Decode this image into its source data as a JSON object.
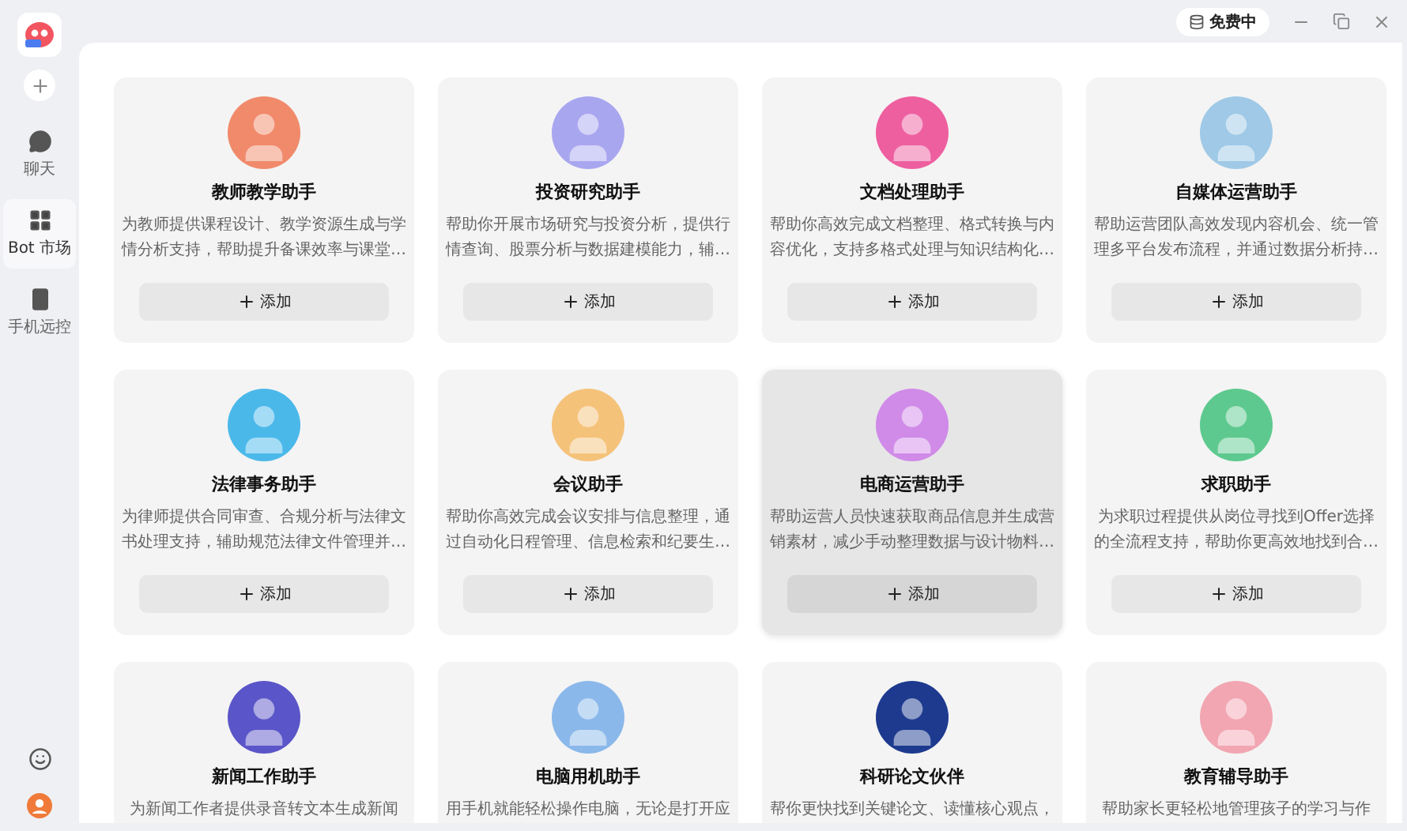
{
  "sidebar": {
    "items": [
      {
        "label": "聊天",
        "selected": false
      },
      {
        "label": "Bot 市场",
        "selected": true
      },
      {
        "label": "手机远控",
        "selected": false
      }
    ]
  },
  "top_bar": {
    "plan_badge": "免费中"
  },
  "cards": [
    {
      "title": "教师教学助手",
      "description": "为教师提供课程设计、教学资源生成与学情分析支持，帮助提升备课效率与课堂…",
      "button": "添加",
      "color": "#f08a6a",
      "highlighted": false
    },
    {
      "title": "投资研究助手",
      "description": "帮助你开展市场研究与投资分析，提供行情查询、股票分析与数据建模能力，辅…",
      "button": "添加",
      "color": "#a9a6f0",
      "highlighted": false
    },
    {
      "title": "文档处理助手",
      "description": "帮助你高效完成文档整理、格式转换与内容优化，支持多格式处理与知识结构化…",
      "button": "添加",
      "color": "#ee5fa0",
      "highlighted": false
    },
    {
      "title": "自媒体运营助手",
      "description": "帮助运营团队高效发现内容机会、统一管理多平台发布流程，并通过数据分析持…",
      "button": "添加",
      "color": "#9fc9e6",
      "highlighted": false
    },
    {
      "title": "法律事务助手",
      "description": "为律师提供合同审查、合规分析与法律文书处理支持，辅助规范法律文件管理并…",
      "button": "添加",
      "color": "#4bb8ea",
      "highlighted": false
    },
    {
      "title": "会议助手",
      "description": "帮助你高效完成会议安排与信息整理，通过自动化日程管理、信息检索和纪要生…",
      "button": "添加",
      "color": "#f5c27a",
      "highlighted": false
    },
    {
      "title": "电商运营助手",
      "description": "帮助运营人员快速获取商品信息并生成营销素材，减少手动整理数据与设计物料…",
      "button": "添加",
      "color": "#d08ae8",
      "highlighted": true
    },
    {
      "title": "求职助手",
      "description": "为求职过程提供从岗位寻找到Offer选择的全流程支持，帮助你更高效地找到合…",
      "button": "添加",
      "color": "#5dc98e",
      "highlighted": false
    },
    {
      "title": "新闻工作助手",
      "description": "为新闻工作者提供录音转文本生成新闻",
      "color": "#5a55c8",
      "highlighted": false
    },
    {
      "title": "电脑用机助手",
      "description": "用手机就能轻松操作电脑，无论是打开应",
      "color": "#8ab8ea",
      "highlighted": false
    },
    {
      "title": "科研论文伙伴",
      "description": "帮你更快找到关键论文、读懂核心观点，",
      "color": "#1d3a8f",
      "highlighted": false
    },
    {
      "title": "教育辅导助手",
      "description": "帮助家长更轻松地管理孩子的学习与作",
      "color": "#f2a6b2",
      "highlighted": false
    }
  ]
}
